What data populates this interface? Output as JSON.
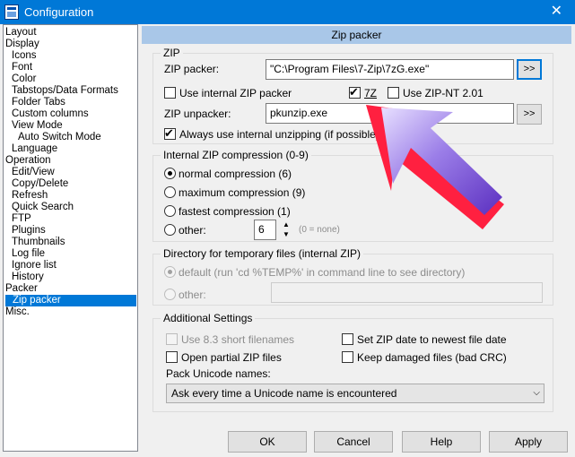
{
  "window": {
    "title": "Configuration",
    "close_glyph": "✕"
  },
  "tree": [
    "Layout",
    "Display",
    "Icons",
    "Font",
    "Color",
    "Tabstops/Data Formats",
    "Folder Tabs",
    "Custom columns",
    "View Mode",
    "Auto Switch Mode",
    "Language",
    "Operation",
    "Edit/View",
    "Copy/Delete",
    "Refresh",
    "Quick Search",
    "FTP",
    "Plugins",
    "Thumbnails",
    "Log file",
    "Ignore list",
    "History",
    "Packer",
    "Zip packer",
    "Misc."
  ],
  "page_title": "Zip packer",
  "zip": {
    "caption": "ZIP",
    "packer_label": "ZIP packer:",
    "packer_value": "\"C:\\Program Files\\7-Zip\\7zG.exe\"",
    "browse": ">>",
    "use_internal": "Use internal ZIP packer",
    "sevenz": "7Z",
    "use_nt": "Use ZIP-NT 2.01",
    "unpacker_label": "ZIP unpacker:",
    "unpacker_value": "pkunzip.exe",
    "always_internal": "Always use internal unzipping (if possible)"
  },
  "compression": {
    "caption": "Internal ZIP compression (0-9)",
    "normal": "normal compression (6)",
    "maximum": "maximum compression (9)",
    "fastest": "fastest compression (1)",
    "other": "other:",
    "other_value": "6",
    "none_hint": "(0 = none)"
  },
  "tempdir": {
    "caption": "Directory for temporary files (internal ZIP)",
    "default": "default (run 'cd %TEMP%' in command line to see directory)",
    "other": "other:"
  },
  "additional": {
    "caption": "Additional Settings",
    "short_names": "Use 8.3 short filenames",
    "set_date": "Set ZIP date to newest file date",
    "open_partial": "Open partial ZIP files",
    "keep_damaged": "Keep damaged files (bad CRC)",
    "unicode_label": "Pack Unicode names:",
    "unicode_value": "Ask every time a Unicode name is encountered"
  },
  "buttons": {
    "ok": "OK",
    "cancel": "Cancel",
    "help": "Help",
    "apply": "Apply"
  }
}
